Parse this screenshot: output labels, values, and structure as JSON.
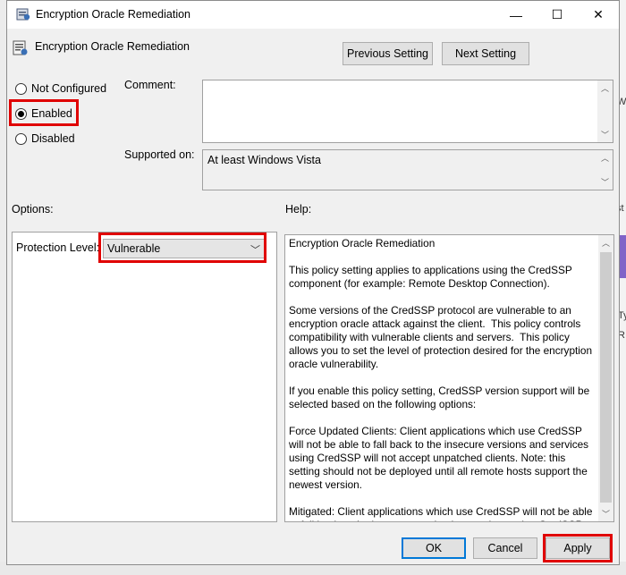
{
  "window": {
    "title": "Encryption Oracle Remediation",
    "minimize": "—",
    "maximize": "☐",
    "close": "✕"
  },
  "header": {
    "setting_name": "Encryption Oracle Remediation",
    "previous_label": "Previous Setting",
    "next_label": "Next Setting"
  },
  "state": {
    "options": [
      {
        "label": "Not Configured",
        "checked": false
      },
      {
        "label": "Enabled",
        "checked": true
      },
      {
        "label": "Disabled",
        "checked": false
      }
    ]
  },
  "comment": {
    "label": "Comment:",
    "value": ""
  },
  "supported": {
    "label": "Supported on:",
    "value": "At least Windows Vista"
  },
  "options_panel": {
    "heading": "Options:",
    "protection_label": "Protection Level:",
    "protection_value": "Vulnerable"
  },
  "help_panel": {
    "heading": "Help:",
    "text": "Encryption Oracle Remediation\n\nThis policy setting applies to applications using the CredSSP component (for example: Remote Desktop Connection).\n\nSome versions of the CredSSP protocol are vulnerable to an encryption oracle attack against the client.  This policy controls compatibility with vulnerable clients and servers.  This policy allows you to set the level of protection desired for the encryption oracle vulnerability.\n\nIf you enable this policy setting, CredSSP version support will be selected based on the following options:\n\nForce Updated Clients: Client applications which use CredSSP will not be able to fall back to the insecure versions and services using CredSSP will not accept unpatched clients. Note: this setting should not be deployed until all remote hosts support the newest version.\n\nMitigated: Client applications which use CredSSP will not be able to fall back to the insecure version but services using CredSSP will accept unpatched clients."
  },
  "footer": {
    "ok_label": "OK",
    "cancel_label": "Cancel",
    "apply_label": "Apply"
  },
  "background_fragments": [
    "W",
    "st",
    "Ty",
    "RI"
  ],
  "colors": {
    "highlight": "#e00000",
    "accent": "#0078d7"
  }
}
